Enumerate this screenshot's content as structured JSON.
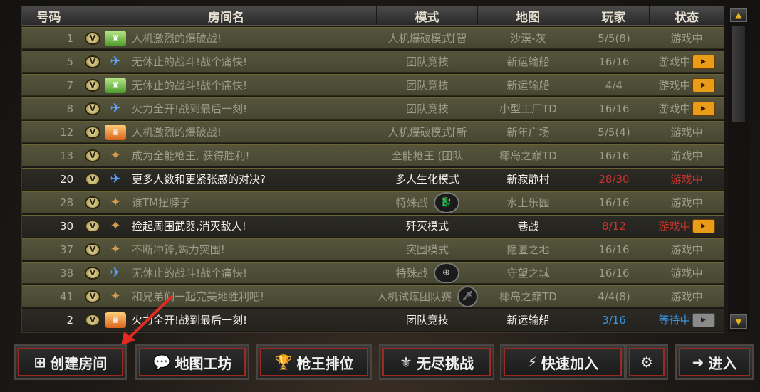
{
  "header": {
    "num": "号码",
    "name": "房间名",
    "mode": "模式",
    "map": "地图",
    "players": "玩家",
    "status": "状态"
  },
  "rows": [
    {
      "num": "1",
      "rank": "green",
      "name": "人机激烈的爆破战!",
      "mode": "人机爆破模式[智",
      "map": "沙漠-灰",
      "players": "5/5(8)",
      "status": "游戏中",
      "style": "dim"
    },
    {
      "num": "5",
      "rank": "blue",
      "name": "无休止的战斗!战个痛快!",
      "mode": "团队竞技",
      "map": "新运输船",
      "players": "16/16",
      "status": "游戏中",
      "style": "dim",
      "tv": true
    },
    {
      "num": "7",
      "rank": "green",
      "name": "无休止的战斗!战个痛快!",
      "mode": "团队竞技",
      "map": "新运输船",
      "players": "4/4",
      "status": "游戏中",
      "style": "dim",
      "tv": true
    },
    {
      "num": "8",
      "rank": "blue",
      "name": "火力全开!战到最后一刻!",
      "mode": "团队竞技",
      "map": "小型工厂TD",
      "players": "16/16",
      "status": "游戏中",
      "style": "dim",
      "tv": true
    },
    {
      "num": "12",
      "rank": "orange",
      "name": "人机激烈的爆破战!",
      "mode": "人机爆破模式[新",
      "map": "新年广场",
      "players": "5/5(4)",
      "status": "游戏中",
      "style": "dim"
    },
    {
      "num": "13",
      "rank": "eagle",
      "name": "成为全能枪王,  获得胜利!",
      "mode": "全能枪王  (团队",
      "map": "椰岛之巅TD",
      "players": "16/16",
      "status": "游戏中",
      "style": "dim"
    },
    {
      "num": "20",
      "rank": "blue",
      "name": "更多人数和更紧张感的对决?",
      "mode": "多人生化模式",
      "map": "新寂静村",
      "players": "28/30",
      "status": "游戏中",
      "style": "bright",
      "red": true
    },
    {
      "num": "28",
      "rank": "eagle",
      "name": "谁TM扭脖子",
      "mode": "特殊战",
      "map": "水上乐园",
      "players": "16/16",
      "status": "游戏中",
      "style": "dim",
      "emblem": "dragon"
    },
    {
      "num": "30",
      "rank": "eagle",
      "name": "捡起周围武器,消灭敌人!",
      "mode": "歼灭模式",
      "map": "巷战",
      "players": "8/12",
      "status": "游戏中",
      "style": "bright",
      "red": true,
      "tv": true
    },
    {
      "num": "37",
      "rank": "eagle",
      "name": "不断冲锋,竭力突围!",
      "mode": "突围模式",
      "map": "隐匿之地",
      "players": "16/16",
      "status": "游戏中",
      "style": "dim"
    },
    {
      "num": "38",
      "rank": "blue",
      "name": "无休止的战斗!战个痛快!",
      "mode": "特殊战",
      "map": "守望之城",
      "players": "16/16",
      "status": "游戏中",
      "style": "dim",
      "emblem": "crosshair"
    },
    {
      "num": "41",
      "rank": "eagle",
      "name": "和兄弟们一起完美地胜利吧!",
      "mode": "人机试炼团队赛",
      "map": "椰岛之巅TD",
      "players": "4/4(8)",
      "status": "游戏中",
      "style": "dim",
      "emblem": "knife"
    },
    {
      "num": "2",
      "rank": "orange",
      "name": "火力全开!战到最后一刻!",
      "mode": "团队竞技",
      "map": "新运输船",
      "players": "3/16",
      "status": "等待中",
      "style": "bright",
      "waiting": true,
      "tv": "grey"
    }
  ],
  "toolbar": {
    "create_room": "创建房间",
    "map_workshop": "地图工坊",
    "ranking": "枪王排位",
    "endless": "无尽挑战",
    "quick_join": "快速加入",
    "enter": "进入"
  },
  "icons": {
    "create_room": "add-room-icon",
    "map_workshop": "chat-icon",
    "ranking": "trophy-icon",
    "endless": "wings-icon",
    "quick_join": "lightning-icon",
    "settings": "gear-icon",
    "enter": "arrow-right-icon"
  },
  "colors": {
    "accent_red": "#9a2a22",
    "full_players": "#c8342c",
    "waiting": "#3c93e0",
    "tv_orange": "#e89c18"
  }
}
